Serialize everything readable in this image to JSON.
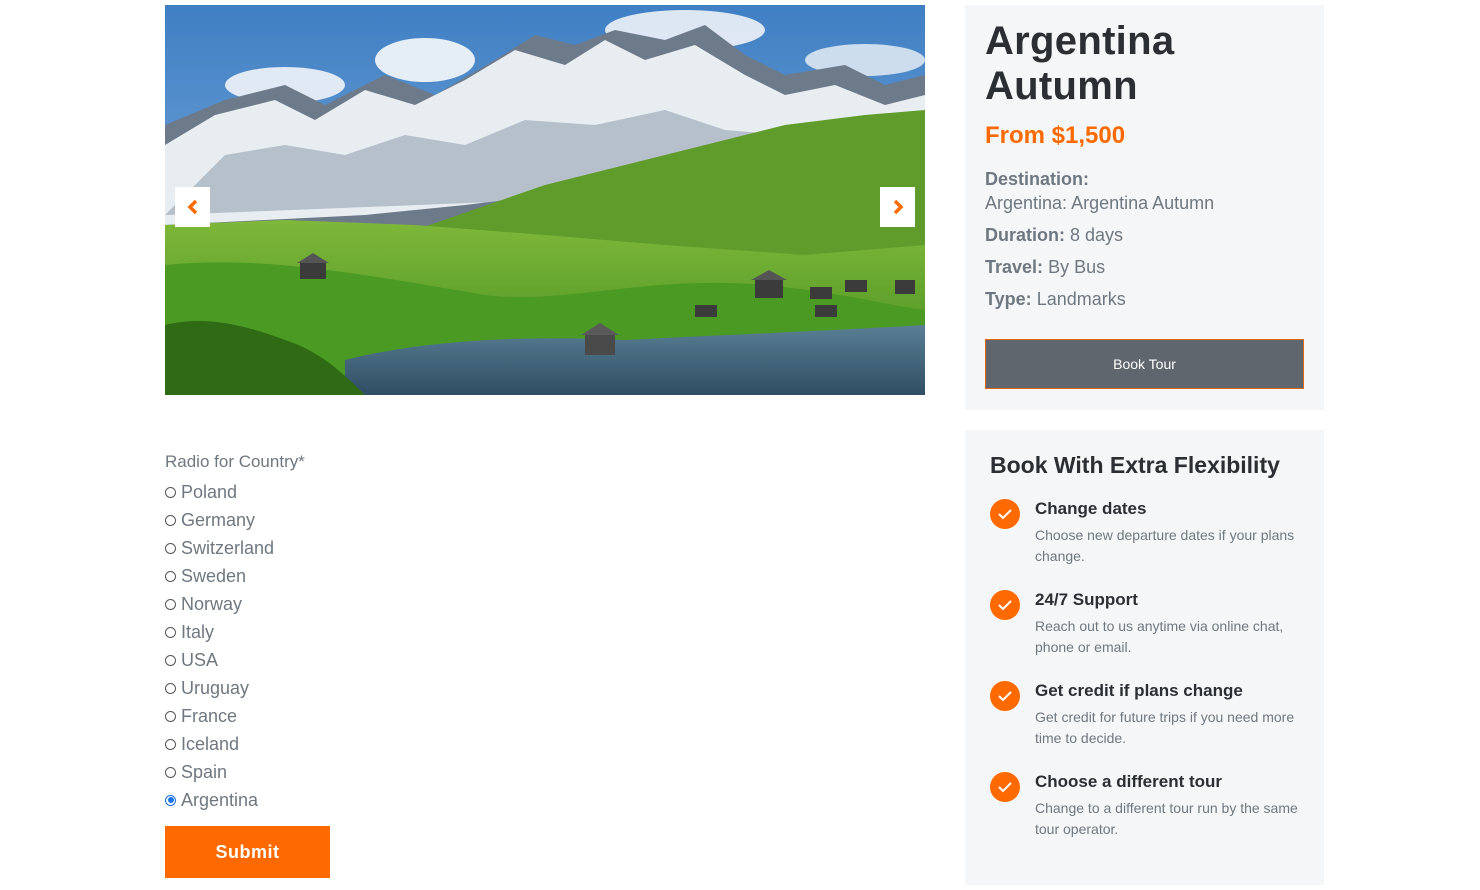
{
  "tour": {
    "title_line1": "Argentina",
    "title_line2": "Autumn",
    "price": "From $1,500",
    "destination_label": "Destination:",
    "destination_value": "Argentina: Argentina Autumn",
    "duration_label": "Duration:",
    "duration_value": "8 days",
    "travel_label": "Travel:",
    "travel_value": "By Bus",
    "type_label": "Type:",
    "type_value": "Landmarks",
    "book_label": "Book Tour"
  },
  "carousel": {
    "prev_icon": "chevron-left-icon",
    "next_icon": "chevron-right-icon"
  },
  "flexibility": {
    "title": "Book With Extra Flexibility",
    "items": [
      {
        "title": "Change dates",
        "desc_line1": "Choose new departure dates if your plans",
        "desc_line2": "change."
      },
      {
        "title": "24/7 Support",
        "desc_line1": "Reach out to us anytime via online chat,",
        "desc_line2": "phone or email."
      },
      {
        "title": "Get credit if plans change",
        "desc_line1": "Get credit for future trips if you need more",
        "desc_line2": "time to decide."
      },
      {
        "title": "Choose a different tour",
        "desc_line1": "Change to a different tour run by the same",
        "desc_line2": "tour operator."
      }
    ]
  },
  "form": {
    "label": "Radio for Country*",
    "options": [
      "Poland",
      "Germany",
      "Switzerland",
      "Sweden",
      "Norway",
      "Italy",
      "USA",
      "Uruguay",
      "France",
      "Iceland",
      "Spain",
      "Argentina"
    ],
    "selected": "Argentina",
    "submit_label": "Submit"
  },
  "colors": {
    "accent": "#ff6a00",
    "button_gray": "#5f666d",
    "card_bg": "#f5f6f8"
  }
}
